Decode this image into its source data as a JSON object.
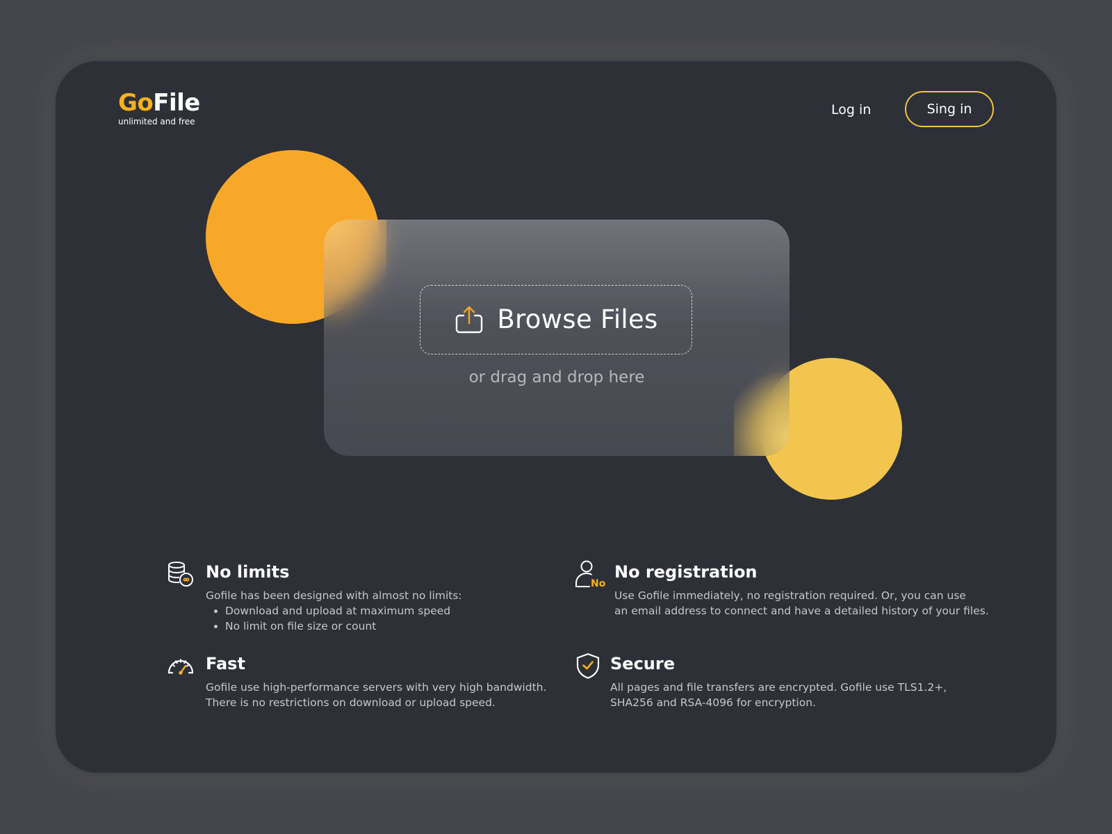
{
  "brand": {
    "go": "Go",
    "file": "File",
    "tagline": "unlimited and free",
    "accent_color": "#f6b21b"
  },
  "nav": {
    "login_label": "Log in",
    "signin_label": "Sing in"
  },
  "upload": {
    "browse_label": "Browse Files",
    "drag_hint": "or drag and drop here",
    "icon": "upload-icon"
  },
  "features": [
    {
      "icon": "database-infinity-icon",
      "title": "No limits",
      "intro": "Gofile has been designed with almost no limits:",
      "bullets": [
        "Download and upload at maximum speed",
        "No limit on file size or count"
      ]
    },
    {
      "icon": "user-no-icon",
      "icon_badge": "No",
      "title": "No registration",
      "lines": [
        "Use Gofile immediately, no registration required. Or, you can use",
        "an email address to connect and have a detailed history of your files."
      ]
    },
    {
      "icon": "speedometer-icon",
      "title": "Fast",
      "lines": [
        "Gofile use high-performance servers with very high bandwidth.",
        "There is no restrictions on download or upload speed."
      ]
    },
    {
      "icon": "shield-check-icon",
      "title": "Secure",
      "lines": [
        "All pages and file transfers are encrypted. Gofile use TLS1.2+,",
        "SHA256 and RSA-4096 for encryption."
      ]
    }
  ]
}
